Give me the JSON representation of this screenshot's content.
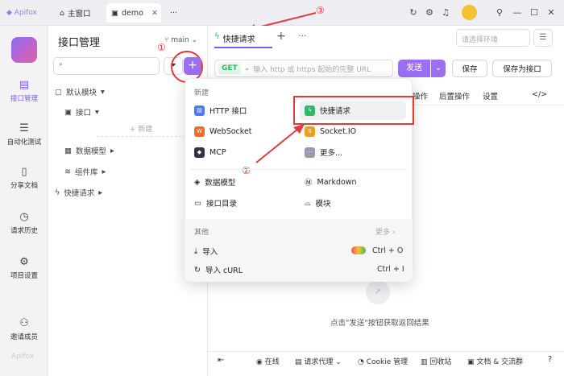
{
  "titlebar": {
    "tabs": [
      {
        "label": "主窗口"
      },
      {
        "label": "demo"
      }
    ],
    "more": "···",
    "annotation3": "③"
  },
  "sidebar": {
    "items": [
      {
        "label": "接口管理"
      },
      {
        "label": "自动化测试"
      },
      {
        "label": "分享文档"
      },
      {
        "label": "请求历史"
      },
      {
        "label": "项目设置"
      },
      {
        "label": "邀请成员"
      }
    ],
    "watermark": "Apifox"
  },
  "panel": {
    "title": "接口管理",
    "branch": "main",
    "search_placeholder": "",
    "tree": [
      {
        "label": "默认模块"
      },
      {
        "label": "接口"
      },
      {
        "label": "+ 新建"
      },
      {
        "label": "数据模型"
      },
      {
        "label": "组件库"
      },
      {
        "label": "快捷请求"
      }
    ],
    "annotation1": "①"
  },
  "main": {
    "tab_label": "快捷请求",
    "env_placeholder": "请选择环境",
    "method": "GET",
    "url_placeholder": "输入 http 或 https 起始的完整 URL",
    "send": "发送",
    "save": "保存",
    "save_as": "保存为接口",
    "subtabs": [
      "操作",
      "后置操作",
      "设置"
    ],
    "empty_hint": "点击\"发送\"按钮获取返回结果"
  },
  "menu": {
    "section_new": "新建",
    "items_left": [
      "HTTP 接口",
      "WebSocket",
      "MCP"
    ],
    "items_right": [
      "快捷请求",
      "Socket.IO",
      "更多..."
    ],
    "items2_left": [
      "数据模型",
      "接口目录"
    ],
    "items2_right": [
      "Markdown",
      "模块"
    ],
    "section_other": "其他",
    "more": "更多",
    "import": "导入",
    "import_shortcut": "Ctrl + O",
    "import_curl": "导入 cURL",
    "curl_shortcut": "Ctrl + I",
    "annotation2": "②"
  },
  "statusbar": {
    "items": [
      "在线",
      "请求代理",
      "Cookie 管理",
      "回收站",
      "文档 & 交流群"
    ]
  }
}
